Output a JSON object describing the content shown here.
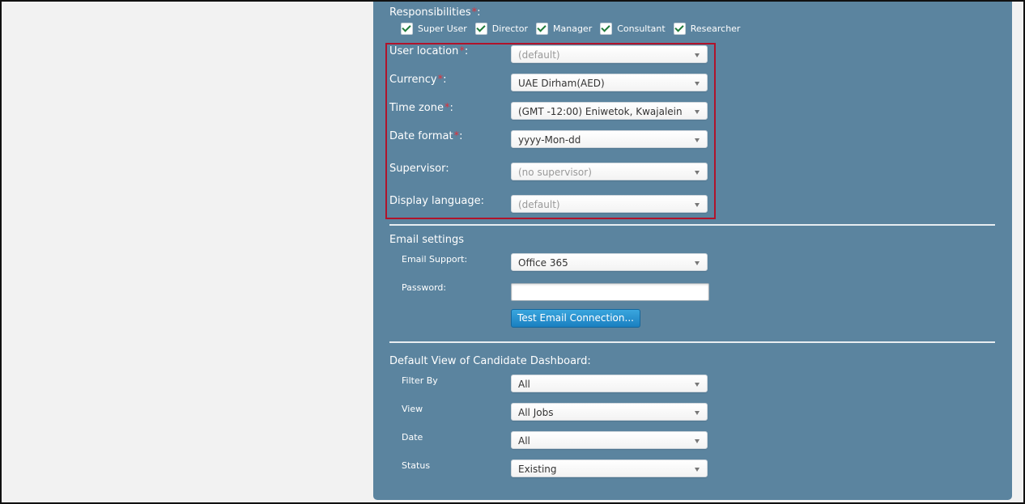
{
  "responsibilities": {
    "label": "Responsibilities",
    "required_mark": "*",
    "suffix": ":",
    "options": [
      {
        "label": "Super User",
        "checked": true
      },
      {
        "label": "Director",
        "checked": true
      },
      {
        "label": "Manager",
        "checked": true
      },
      {
        "label": "Consultant",
        "checked": true
      },
      {
        "label": "Researcher",
        "checked": true
      }
    ]
  },
  "fields": {
    "user_location": {
      "label": "User location",
      "required_mark": "*",
      "suffix": ":",
      "value": "(default)"
    },
    "currency": {
      "label": "Currency",
      "required_mark": "*",
      "suffix": ":",
      "value": "UAE Dirham(AED)"
    },
    "time_zone": {
      "label": "Time zone",
      "required_mark": "*",
      "suffix": ":",
      "value": "(GMT -12:00) Eniwetok, Kwajalein"
    },
    "date_format": {
      "label": "Date format",
      "required_mark": "*",
      "suffix": ":",
      "value": "yyyy-Mon-dd"
    },
    "supervisor": {
      "label": "Supervisor:",
      "value": "(no supervisor)"
    },
    "display_language": {
      "label": "Display language:",
      "value": "(default)"
    }
  },
  "email_settings": {
    "title": "Email settings",
    "support_label": "Email Support:",
    "support_value": "Office 365",
    "password_label": "Password:",
    "password_value": "",
    "test_button": "Test Email Connection..."
  },
  "dashboard": {
    "title": "Default View of Candidate Dashboard:",
    "filter_by": {
      "label": "Filter By",
      "value": "All"
    },
    "view": {
      "label": "View",
      "value": "All Jobs"
    },
    "date": {
      "label": "Date",
      "value": "All"
    },
    "status": {
      "label": "Status",
      "value": "Existing"
    }
  },
  "colors": {
    "panel": "#5b849f",
    "highlight_border": "#b0132b",
    "required": "#e0303a",
    "checkmark": "#1f7a3a",
    "button": "#1a7fc0"
  }
}
